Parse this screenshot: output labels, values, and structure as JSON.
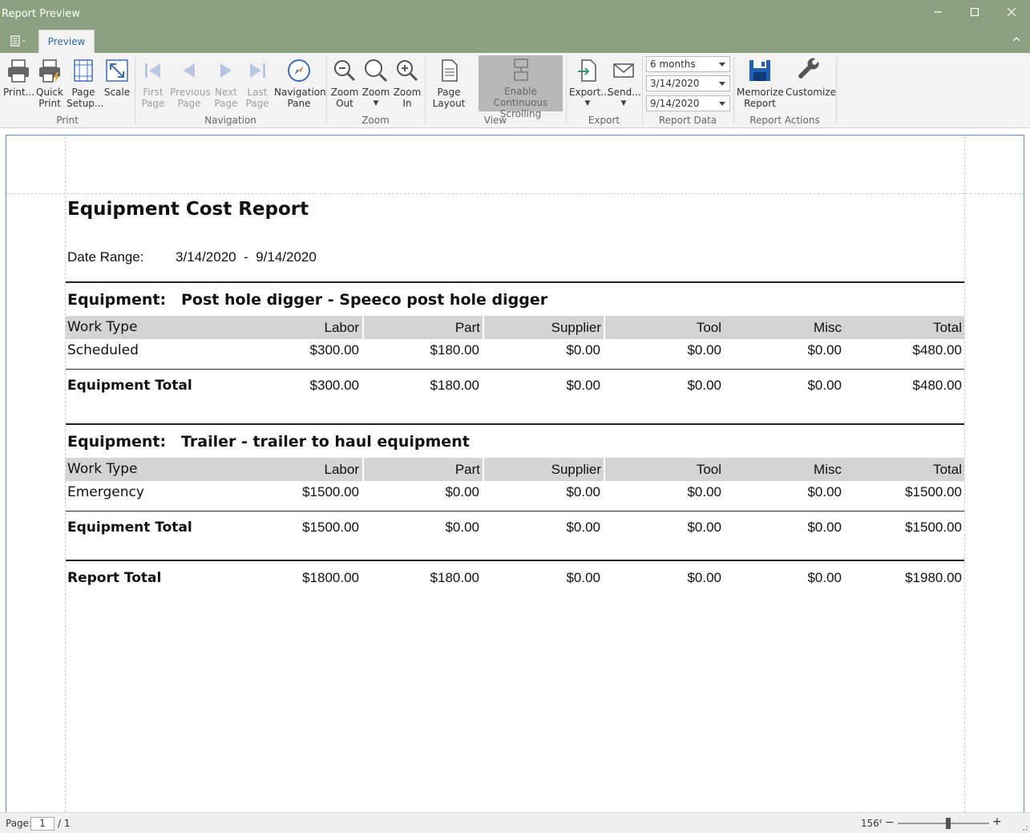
{
  "window": {
    "title": "Report Preview",
    "minimize_icon": "minimize-icon",
    "maximize_icon": "maximize-icon",
    "close_icon": "close-icon"
  },
  "ribbon": {
    "tab": "Preview",
    "groups": {
      "print": "Print",
      "navigation": "Navigation",
      "zoom": "Zoom",
      "view": "View",
      "export": "Export",
      "report_data": "Report Data",
      "report_actions": "Report Actions"
    },
    "buttons": {
      "print": "Print...",
      "quick_print": "Quick\nPrint",
      "page_setup": "Page\nSetup...",
      "scale": "Scale",
      "first_page": "First\nPage",
      "previous_page": "Previous\nPage",
      "next_page": "Next\nPage",
      "last_page": "Last\nPage",
      "navigation_pane": "Navigation\nPane",
      "zoom_out": "Zoom\nOut",
      "zoom": "Zoom",
      "zoom_in": "Zoom\nIn",
      "page_layout": "Page\nLayout",
      "continuous_scrolling": "Enable Continuous\nScrolling",
      "export": "Export...",
      "send": "Send...",
      "memorize_report": "Memorize\nReport",
      "customize": "Customize"
    },
    "report_data": {
      "period": "6 months",
      "start_date": "3/14/2020",
      "end_date": "9/14/2020"
    },
    "colors": {
      "titlebar": "#8ba07e",
      "tab_text": "#2b6cb0",
      "active_button": "#b8b8b8"
    }
  },
  "report": {
    "title": "Equipment Cost Report",
    "date_range_label": "Date Range:",
    "date_range_value": "3/14/2020  -  9/14/2020",
    "equipment_label": "Equipment:",
    "columns": [
      "Work Type",
      "Labor",
      "Part",
      "Supplier",
      "Tool",
      "Misc",
      "Total"
    ],
    "sections": [
      {
        "name": "Post hole digger - Speeco post hole digger",
        "rows": [
          {
            "work_type": "Scheduled",
            "labor": "$300.00",
            "part": "$180.00",
            "supplier": "$0.00",
            "tool": "$0.00",
            "misc": "$0.00",
            "total": "$480.00"
          }
        ],
        "total_label": "Equipment Total",
        "totals": {
          "labor": "$300.00",
          "part": "$180.00",
          "supplier": "$0.00",
          "tool": "$0.00",
          "misc": "$0.00",
          "total": "$480.00"
        }
      },
      {
        "name": "Trailer - trailer to haul equipment",
        "rows": [
          {
            "work_type": "Emergency",
            "labor": "$1500.00",
            "part": "$0.00",
            "supplier": "$0.00",
            "tool": "$0.00",
            "misc": "$0.00",
            "total": "$1500.00"
          }
        ],
        "total_label": "Equipment Total",
        "totals": {
          "labor": "$1500.00",
          "part": "$0.00",
          "supplier": "$0.00",
          "tool": "$0.00",
          "misc": "$0.00",
          "total": "$1500.00"
        }
      }
    ],
    "report_total_label": "Report Total",
    "report_totals": {
      "labor": "$1800.00",
      "part": "$180.00",
      "supplier": "$0.00",
      "tool": "$0.00",
      "misc": "$0.00",
      "total": "$1980.00"
    }
  },
  "status": {
    "page_label": "Page:",
    "page_current": "1",
    "page_of": "/ 1",
    "zoom_value": "156%",
    "zoom_minus": "−",
    "zoom_plus": "+"
  }
}
